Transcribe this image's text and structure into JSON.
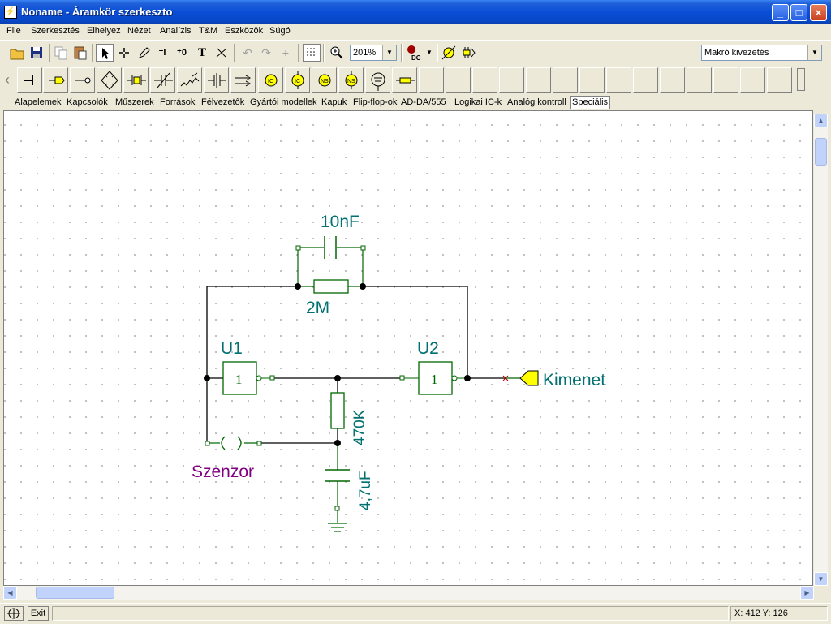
{
  "window": {
    "title": "Noname - Áramkör szerkeszto",
    "minimize": "_",
    "maximize": "□",
    "close": "×"
  },
  "menu": [
    "File",
    "Szerkesztés",
    "Elhelyez",
    "Nézet",
    "Analízis",
    "T&M",
    "Eszközök",
    "Súgó"
  ],
  "toolbar": {
    "zoom": "201%",
    "macro_select": "Makró kivezetés",
    "text_tool": "T",
    "dc_label": "DC"
  },
  "tabs": [
    "Alapelemek",
    "Kapcsolók",
    "Műszerek",
    "Források",
    "Félvezetők",
    "Gyártói modellek",
    "Kapuk",
    "Flip-flop-ok",
    "AD-DA/555",
    "Logikai IC-k",
    "Analóg kontroll",
    "Speciális"
  ],
  "selected_tab": "Speciális",
  "schematic": {
    "cap_top": "10nF",
    "res_top": "2M",
    "gate1_name": "U1",
    "gate2_name": "U2",
    "gate_symbol": "1",
    "output_label": "Kimenet",
    "res_mid": "470K",
    "cap_bottom": "4,7uF",
    "sensor_label": "Szenzor"
  },
  "colors": {
    "wire": "#000000",
    "component": "#006600",
    "label_teal": "#007070",
    "label_purple": "#800080",
    "output_fill": "#ffff00",
    "grid_dot": "#b8b8b8"
  },
  "status": {
    "exit_label": "Exit",
    "coords": "X: 412 Y: 126"
  }
}
